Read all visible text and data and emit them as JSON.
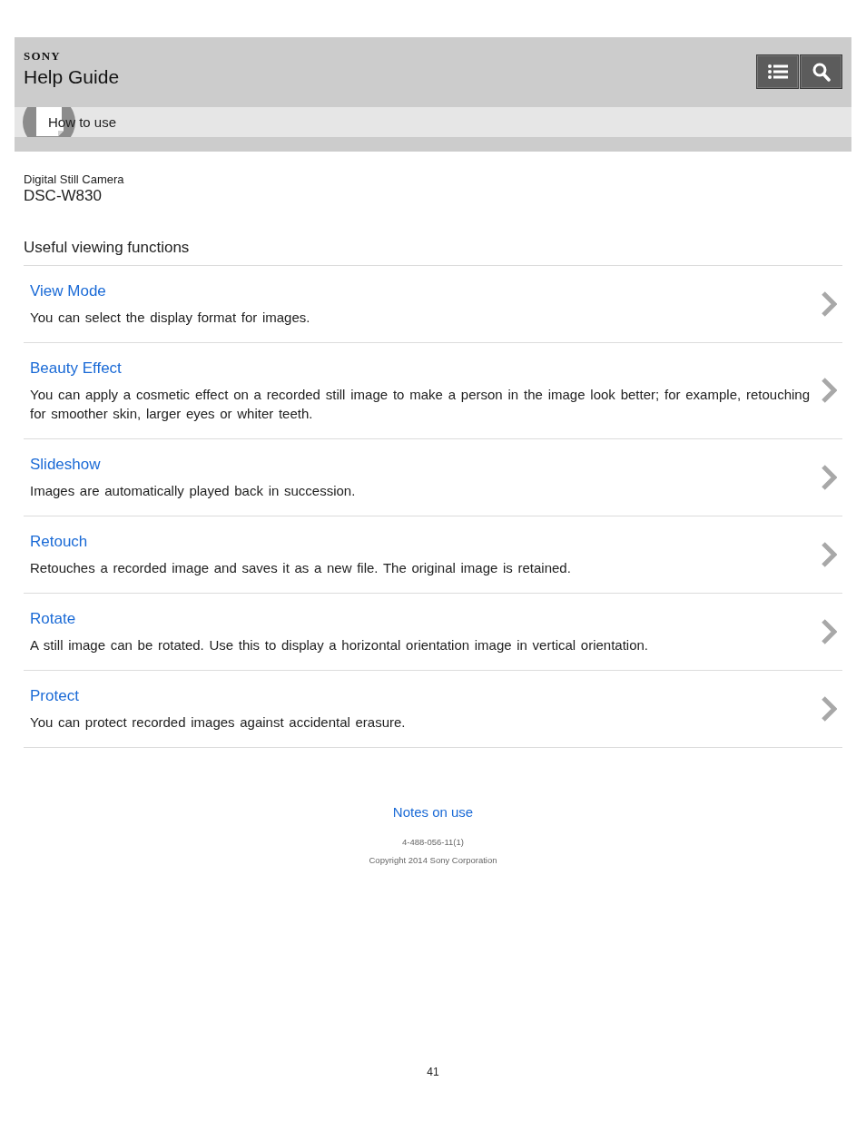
{
  "header": {
    "logo": "SONY",
    "title": "Help Guide"
  },
  "breadcrumb": {
    "label": "How to use"
  },
  "product": {
    "category": "Digital Still Camera",
    "model": "DSC-W830"
  },
  "section": {
    "title": "Useful viewing functions",
    "items": [
      {
        "title": "View Mode",
        "description": "You can select the display format for images."
      },
      {
        "title": "Beauty Effect",
        "description": "You can apply a cosmetic effect on a recorded still image to make a person in the image look better; for example, retouching for smoother skin, larger eyes or whiter teeth."
      },
      {
        "title": "Slideshow",
        "description": "Images are automatically played back in succession."
      },
      {
        "title": "Retouch",
        "description": "Retouches a recorded image and saves it as a new file. The original image is retained."
      },
      {
        "title": "Rotate",
        "description": "A still image can be rotated. Use this to display a horizontal orientation image in vertical orientation."
      },
      {
        "title": "Protect",
        "description": "You can protect recorded images against accidental erasure."
      }
    ]
  },
  "footer": {
    "link": "Notes on use",
    "code": "4-488-056-11(1)",
    "copyright": "Copyright 2014 Sony Corporation"
  },
  "page_number": "41"
}
